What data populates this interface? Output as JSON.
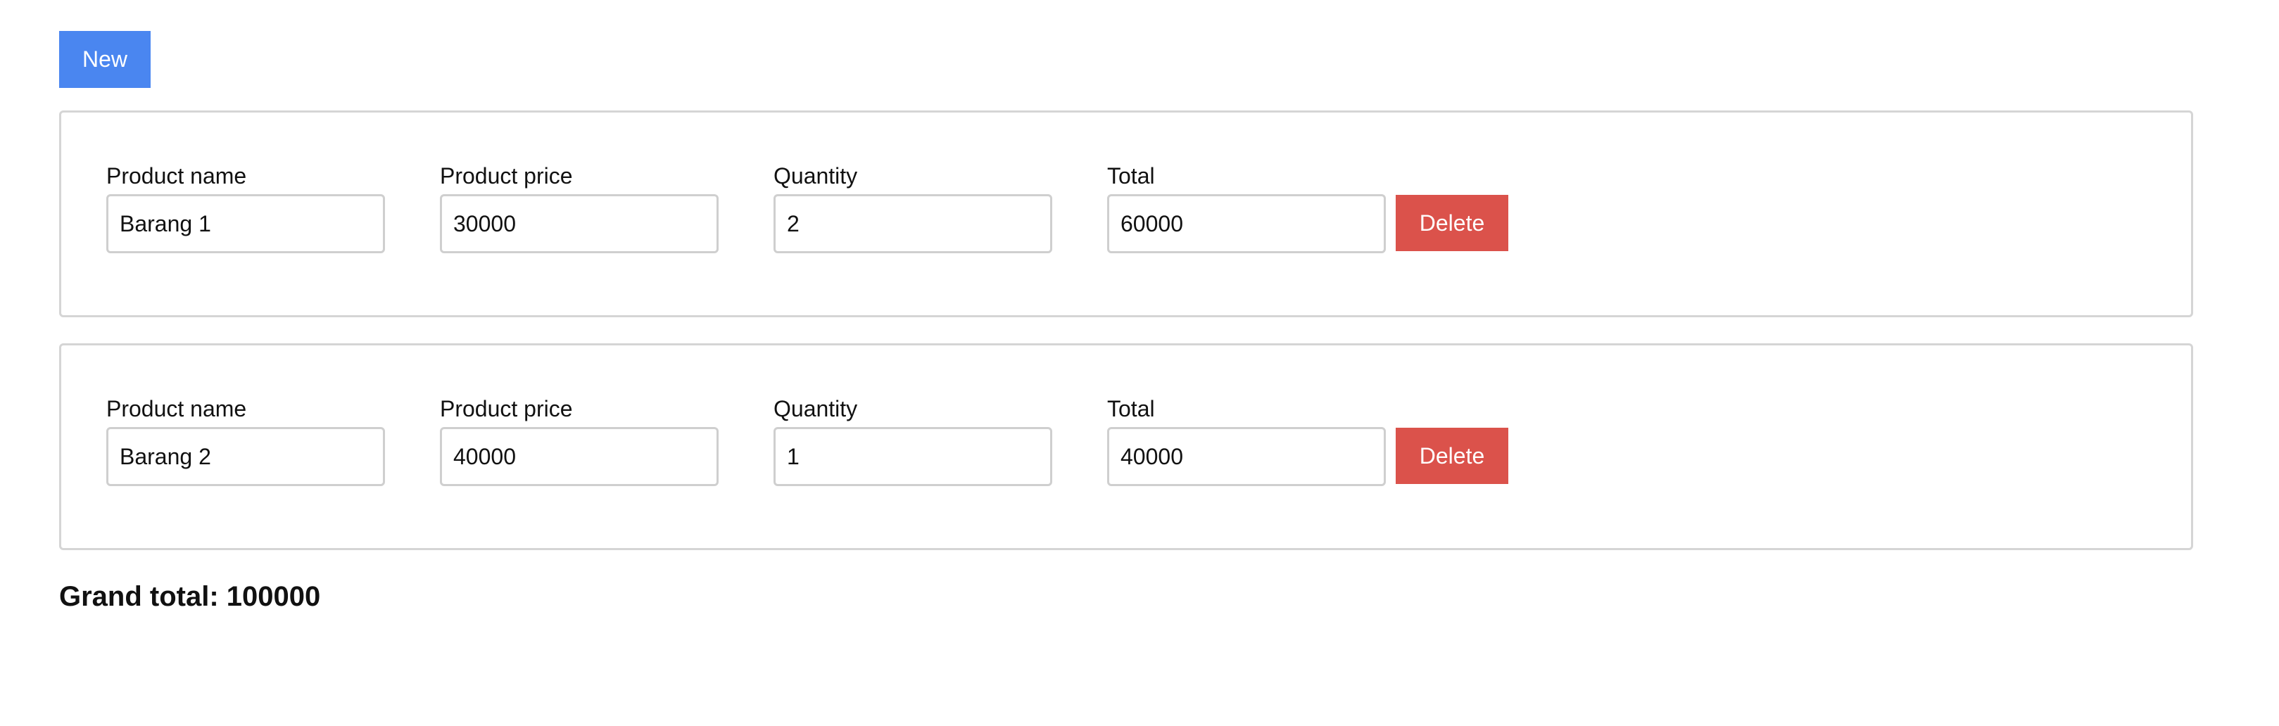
{
  "toolbar": {
    "new_label": "New"
  },
  "items": [
    {
      "product_name_label": "Product name",
      "product_name_value": "Barang 1",
      "product_price_label": "Product price",
      "product_price_value": "30000",
      "quantity_label": "Quantity",
      "quantity_value": "2",
      "total_label": "Total",
      "total_value": "60000",
      "delete_label": "Delete"
    },
    {
      "product_name_label": "Product name",
      "product_name_value": "Barang 2",
      "product_price_label": "Product price",
      "product_price_value": "40000",
      "quantity_label": "Quantity",
      "quantity_value": "1",
      "total_label": "Total",
      "total_value": "40000",
      "delete_label": "Delete"
    }
  ],
  "summary": {
    "grand_total_text": "Grand total: 100000"
  },
  "colors": {
    "new_button": "#4a86f0",
    "delete_button": "#db524b",
    "card_border": "#d5d5d5",
    "input_border": "#cfcfcf"
  }
}
